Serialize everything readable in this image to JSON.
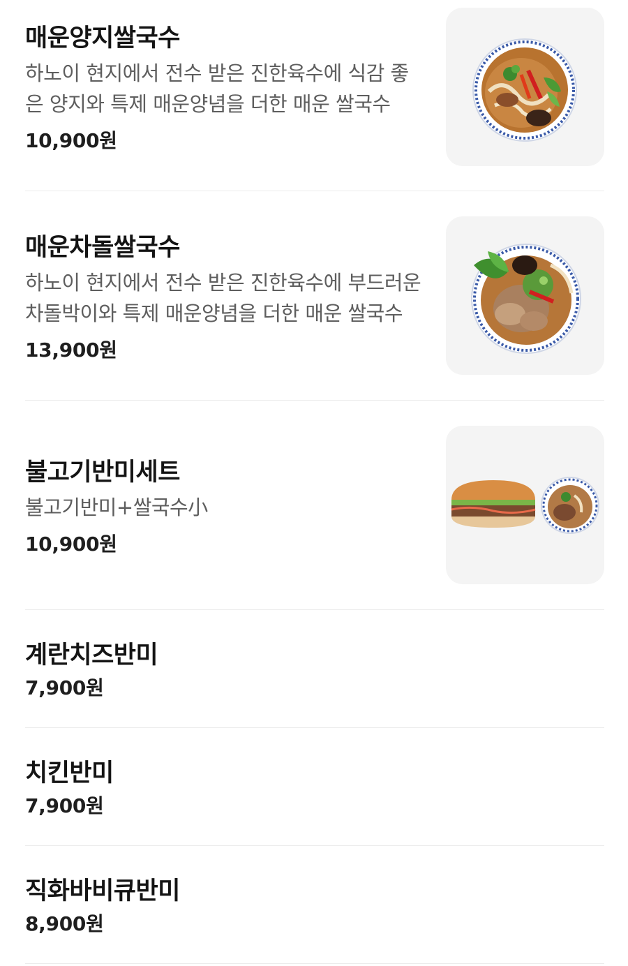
{
  "menu": {
    "items": [
      {
        "name": "매운양지쌀국수",
        "description": "하노이 현지에서 전수 받은 진한육수에 식감 좋은 양지와 특제 매운양념을 더한 매운 쌀국수",
        "price": "10,900원",
        "image": "spicy-brisket-pho-photo"
      },
      {
        "name": "매운차돌쌀국수",
        "description": "하노이 현지에서 전수 받은 진한육수에 부드러운 차돌박이와 특제 매운양념을 더한 매운 쌀국수",
        "price": "13,900원",
        "image": "spicy-chadol-pho-photo"
      },
      {
        "name": "불고기반미세트",
        "description": "불고기반미+쌀국수小",
        "price": "10,900원",
        "image": "bulgogi-banhmi-set-photo"
      },
      {
        "name": "계란치즈반미",
        "price": "7,900원"
      },
      {
        "name": "치킨반미",
        "price": "7,900원"
      },
      {
        "name": "직화바비큐반미",
        "price": "8,900원"
      }
    ]
  },
  "colors": {
    "title": "#141414",
    "description": "#5e5e5e",
    "divider": "#ececec",
    "thumb_bg": "#f4f4f4"
  }
}
